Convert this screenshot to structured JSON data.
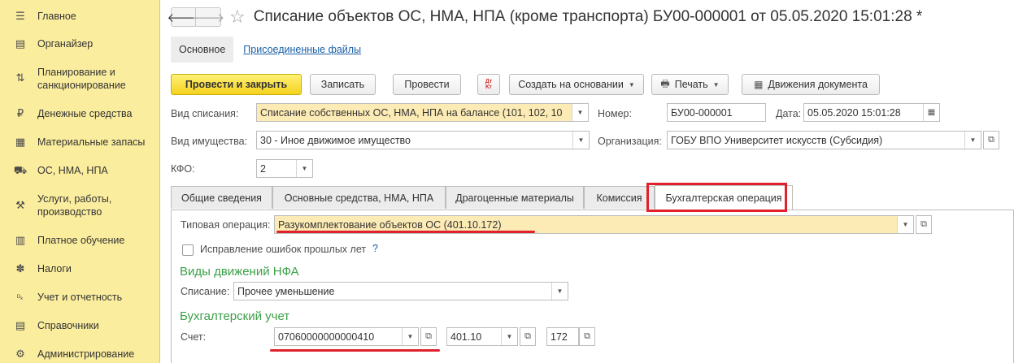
{
  "sidebar": {
    "items": [
      {
        "label": "Главное",
        "icon": "menu-icon",
        "glyph": "☰"
      },
      {
        "label": "Органайзер",
        "icon": "organizer-icon",
        "glyph": "▤"
      },
      {
        "label": "Планирование и санкционирование",
        "icon": "planning-icon",
        "glyph": "⇅"
      },
      {
        "label": "Денежные средства",
        "icon": "money-icon",
        "glyph": "₽"
      },
      {
        "label": "Материальные запасы",
        "icon": "materials-icon",
        "glyph": "▦"
      },
      {
        "label": "ОС, НМА, НПА",
        "icon": "truck-icon",
        "glyph": "⛟"
      },
      {
        "label": "Услуги, работы, производство",
        "icon": "services-icon",
        "glyph": "⚒"
      },
      {
        "label": "Платное обучение",
        "icon": "education-icon",
        "glyph": "▥"
      },
      {
        "label": "Налоги",
        "icon": "taxes-icon",
        "glyph": "✽"
      },
      {
        "label": "Учет и отчетность",
        "icon": "accounting-icon",
        "glyph": "ᴰₖ"
      },
      {
        "label": "Справочники",
        "icon": "directories-icon",
        "glyph": "▤"
      },
      {
        "label": "Администрирование",
        "icon": "gear-icon",
        "glyph": "⚙"
      }
    ]
  },
  "header": {
    "title": "Списание объектов ОС, НМА, НПА (кроме транспорта) БУ00-000001 от 05.05.2020 15:01:28 *",
    "back_glyph": "🡐",
    "forward_glyph": "🡒",
    "star_glyph": "☆"
  },
  "nav": {
    "main_tab": "Основное",
    "files_link": "Присоединенные файлы"
  },
  "toolbar": {
    "post_close": "Провести и закрыть",
    "save": "Записать",
    "post": "Провести",
    "dtkt_top": "Дт",
    "dtkt_bottom": "Кт",
    "create_basis": "Создать на основании",
    "print": "Печать",
    "movements": "Движения документа"
  },
  "form": {
    "writeoff_type_label": "Вид списания:",
    "writeoff_type_value": "Списание собственных ОС, НМА, НПА на балансе (101, 102, 10",
    "number_label": "Номер:",
    "number_value": "БУ00-000001",
    "date_label": "Дата:",
    "date_value": "05.05.2020 15:01:28",
    "property_type_label": "Вид имущества:",
    "property_type_value": "30 - Иное движимое имущество",
    "org_label": "Организация:",
    "org_value": "ГОБУ ВПО Университет искусств (Субсидия)",
    "kfo_label": "КФО:",
    "kfo_value": "2"
  },
  "tabs": [
    {
      "label": "Общие сведения"
    },
    {
      "label": "Основные средства, НМА, НПА"
    },
    {
      "label": "Драгоценные материалы"
    },
    {
      "label": "Комиссия"
    },
    {
      "label": "Бухгалтерская операция"
    }
  ],
  "operation": {
    "typical_label": "Типовая операция:",
    "typical_value": "Разукомплектование объектов ОС (401.10.172)",
    "fix_errors_label": "Исправление ошибок прошлых лет",
    "help": "?",
    "nfa_section": "Виды движений НФА",
    "writeoff_label": "Списание:",
    "writeoff_value": "Прочее уменьшение",
    "accounting_section": "Бухгалтерский учет",
    "account_label": "Счет:",
    "account_value": "07060000000000410",
    "account2_value": "401.10",
    "account3_value": "172"
  },
  "colors": {
    "sidebar_bg": "#fbed9e",
    "primary_button": "#f5d21f",
    "highlight_red": "#e0202a",
    "section_green": "#3c9f48",
    "link_blue": "#1a5fa8"
  }
}
